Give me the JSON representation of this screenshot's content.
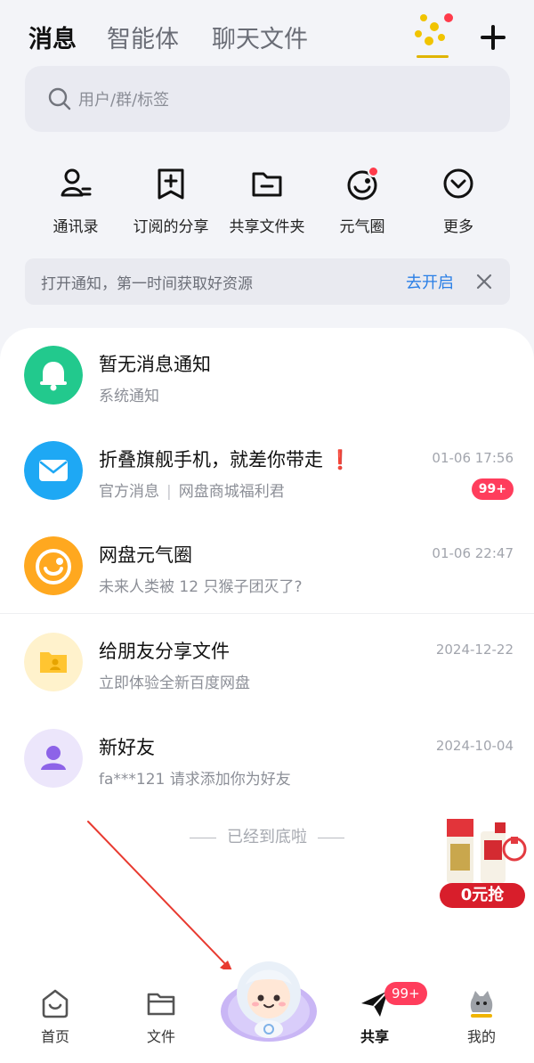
{
  "header": {
    "tabs": [
      {
        "label": "消息"
      },
      {
        "label": "智能体"
      },
      {
        "label": "聊天文件"
      }
    ]
  },
  "search": {
    "placeholder": "用户/群/标签"
  },
  "quick_actions": [
    {
      "label": "通讯录"
    },
    {
      "label": "订阅的分享"
    },
    {
      "label": "共享文件夹"
    },
    {
      "label": "元气圈"
    },
    {
      "label": "更多"
    }
  ],
  "notice": {
    "text": "打开通知，第一时间获取好资源",
    "action": "去开启"
  },
  "messages": [
    {
      "title": "暂无消息通知",
      "subtitle": "系统通知",
      "time": ""
    },
    {
      "title": "折叠旗舰手机，就差你带走",
      "title_mark": "❗",
      "subtitle_a": "官方消息",
      "subtitle_b": "网盘商城福利君",
      "time": "01-06 17:56",
      "badge": "99+"
    },
    {
      "title": "网盘元气圈",
      "subtitle": "未来人类被 12 只猴子团灭了?",
      "time": "01-06 22:47"
    },
    {
      "title": "给朋友分享文件",
      "subtitle": "立即体验全新百度网盘",
      "time": "2024-12-22"
    },
    {
      "title": "新好友",
      "subtitle": "fa***121 请求添加你为好友",
      "time": "2024-10-04"
    }
  ],
  "list_end": "已经到底啦",
  "promo": {
    "label": "0元抢"
  },
  "tabbar": {
    "items": [
      {
        "label": "首页"
      },
      {
        "label": "文件"
      },
      {
        "label": "共享",
        "badge": "99+"
      },
      {
        "label": "我的"
      }
    ]
  },
  "colors": {
    "accent_blue": "#2a7fe6",
    "badge_red": "#ff3d5c",
    "system_green": "#22c98d",
    "official_blue": "#1ea8f4",
    "circle_orange": "#ffa81f",
    "friend_purple": "#8d63e8"
  },
  "icons": {
    "search": "search-icon",
    "plus": "plus-icon",
    "contacts": "contacts-icon",
    "subscribe": "subscribe-share-icon",
    "folder": "shared-folder-icon",
    "circle": "vitality-circle-icon",
    "more": "more-chevron-icon"
  }
}
